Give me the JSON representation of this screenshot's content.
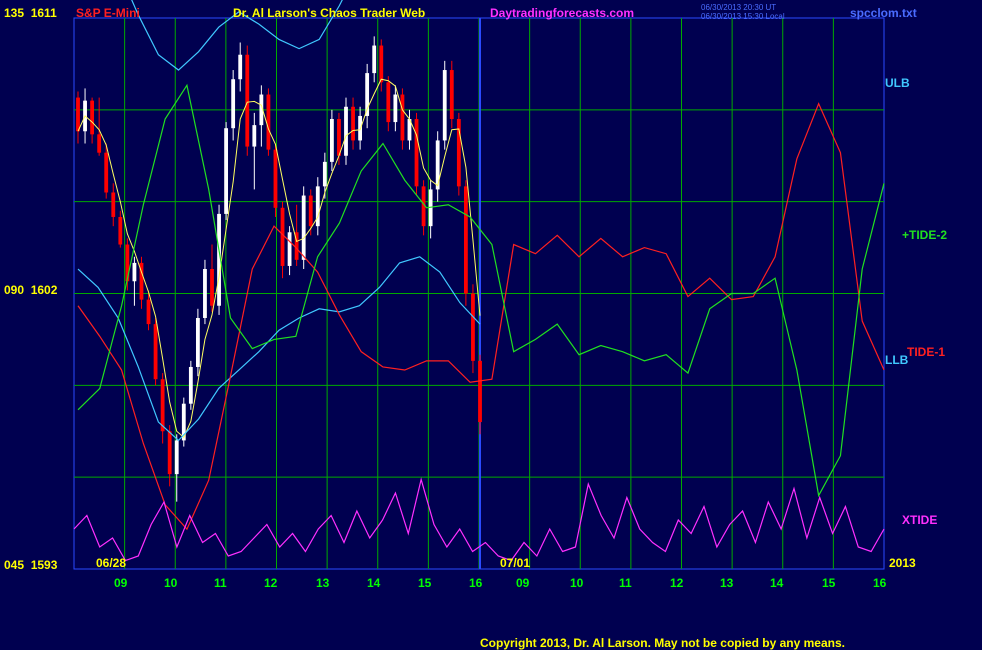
{
  "header": {
    "instrument": "S&P E-Mini",
    "title": "Dr. Al Larson's Chaos Trader Web",
    "site": "Daytradingforecasts.com",
    "stamp1": "06/30/2013 20:30 UT",
    "stamp2": "06/30/2013 15:30 Local",
    "filename": "spcclom.txt"
  },
  "colors": {
    "background": "#000050",
    "grid": "#00aa00",
    "now_line": "#2a4aff",
    "ulb": "#40c8ff",
    "llb": "#40c8ff",
    "tide1": "#ff2020",
    "tide2": "#20e020",
    "xtide": "#ff30ff",
    "up_bar": "#ffffff",
    "down_bar": "#ff0000",
    "text_yellow": "#ffff00"
  },
  "footer": {
    "copyright": "Copyright 2013, Dr. Al Larson. May not be copied by any means."
  },
  "chart_data": {
    "type": "line",
    "y_axis_labels": [
      {
        "code": "135",
        "price": "1611"
      },
      {
        "code": "090",
        "price": "1602"
      },
      {
        "code": "045",
        "price": "1593"
      }
    ],
    "ylim": [
      1593,
      1611
    ],
    "x_hours": [
      "09",
      "10",
      "11",
      "12",
      "13",
      "14",
      "15",
      "16",
      "09",
      "10",
      "11",
      "12",
      "13",
      "14",
      "15",
      "16"
    ],
    "date_labels": {
      "start": "06/28",
      "mid": "07/01",
      "end": "2013"
    },
    "curve_labels": {
      "ulb": "ULB",
      "tide2": "+TIDE-2",
      "tide1": "TIDE-1",
      "llb": "LLB",
      "xtide": "XTIDE"
    },
    "price_bars": [
      [
        1608.4,
        1608.6,
        1606.9,
        1607.3
      ],
      [
        1607.3,
        1608.7,
        1606.9,
        1608.3
      ],
      [
        1608.3,
        1608.4,
        1606.9,
        1607.2
      ],
      [
        1607.2,
        1608.4,
        1606.5,
        1606.6
      ],
      [
        1606.6,
        1606.9,
        1605.1,
        1605.3
      ],
      [
        1605.3,
        1605.6,
        1604.2,
        1604.5
      ],
      [
        1604.5,
        1604.7,
        1603.5,
        1603.6
      ],
      [
        1603.6,
        1603.8,
        1602.1,
        1602.4
      ],
      [
        1602.4,
        1603.2,
        1601.6,
        1603.0
      ],
      [
        1603.0,
        1603.2,
        1601.5,
        1601.8
      ],
      [
        1601.8,
        1602.1,
        1600.8,
        1601.0
      ],
      [
        1601.0,
        1601.2,
        1599.0,
        1599.2
      ],
      [
        1599.2,
        1599.4,
        1597.1,
        1597.5
      ],
      [
        1597.5,
        1597.7,
        1595.7,
        1596.1
      ],
      [
        1596.1,
        1597.4,
        1595.2,
        1597.2
      ],
      [
        1597.2,
        1598.6,
        1597.0,
        1598.4
      ],
      [
        1598.4,
        1599.8,
        1598.2,
        1599.6
      ],
      [
        1599.6,
        1601.5,
        1599.3,
        1601.2
      ],
      [
        1601.2,
        1603.1,
        1601.0,
        1602.8
      ],
      [
        1602.8,
        1603.6,
        1601.4,
        1601.6
      ],
      [
        1601.6,
        1604.9,
        1601.3,
        1604.6
      ],
      [
        1604.6,
        1607.6,
        1604.4,
        1607.4
      ],
      [
        1607.4,
        1609.3,
        1607.0,
        1609.0
      ],
      [
        1609.0,
        1610.2,
        1608.6,
        1609.8
      ],
      [
        1609.8,
        1610.1,
        1606.5,
        1606.8
      ],
      [
        1606.8,
        1607.9,
        1605.4,
        1607.5
      ],
      [
        1607.5,
        1608.8,
        1606.8,
        1608.5
      ],
      [
        1608.5,
        1608.7,
        1606.5,
        1606.7
      ],
      [
        1606.7,
        1606.9,
        1604.5,
        1604.8
      ],
      [
        1604.8,
        1605.0,
        1602.5,
        1602.9
      ],
      [
        1602.9,
        1604.2,
        1602.6,
        1604.0
      ],
      [
        1604.0,
        1604.9,
        1602.9,
        1603.1
      ],
      [
        1603.1,
        1605.5,
        1602.8,
        1605.2
      ],
      [
        1605.2,
        1605.4,
        1603.9,
        1604.2
      ],
      [
        1604.2,
        1605.8,
        1603.9,
        1605.5
      ],
      [
        1605.5,
        1606.6,
        1605.1,
        1606.3
      ],
      [
        1606.3,
        1608.0,
        1606.0,
        1607.7
      ],
      [
        1607.7,
        1607.9,
        1606.2,
        1606.5
      ],
      [
        1606.5,
        1608.4,
        1606.2,
        1608.1
      ],
      [
        1608.1,
        1608.4,
        1606.7,
        1607.0
      ],
      [
        1607.0,
        1608.1,
        1606.7,
        1607.8
      ],
      [
        1607.8,
        1609.5,
        1607.4,
        1609.2
      ],
      [
        1609.2,
        1610.4,
        1608.9,
        1610.1
      ],
      [
        1610.1,
        1610.3,
        1608.6,
        1608.9
      ],
      [
        1608.9,
        1609.1,
        1607.3,
        1607.6
      ],
      [
        1607.6,
        1608.8,
        1607.3,
        1608.5
      ],
      [
        1608.5,
        1608.7,
        1606.7,
        1607.0
      ],
      [
        1607.0,
        1608.0,
        1606.7,
        1607.7
      ],
      [
        1607.7,
        1607.9,
        1605.2,
        1605.5
      ],
      [
        1605.5,
        1605.7,
        1603.9,
        1604.2
      ],
      [
        1604.2,
        1605.7,
        1603.8,
        1605.4
      ],
      [
        1605.4,
        1607.3,
        1605.0,
        1607.0
      ],
      [
        1607.0,
        1609.6,
        1606.7,
        1609.3
      ],
      [
        1609.3,
        1609.6,
        1607.4,
        1607.7
      ],
      [
        1607.7,
        1607.9,
        1605.2,
        1605.5
      ],
      [
        1605.5,
        1605.7,
        1601.6,
        1602.0
      ],
      [
        1602.0,
        1602.3,
        1599.4,
        1599.8
      ],
      [
        1599.8,
        1600.0,
        1597.4,
        1597.8
      ]
    ],
    "series": [
      {
        "name": "ULB",
        "y": [
          1614.4,
          1614.1,
          1612.6,
          1611.1,
          1609.8,
          1609.3,
          1609.9,
          1610.7,
          1611.2,
          1610.8,
          1610.3,
          1610.0,
          1610.3,
          1611.4,
          1612.7,
          1613.6,
          1614.3,
          1614.9,
          1614.6,
          1613.4,
          1612.3
        ]
      },
      {
        "name": "LLB",
        "y": [
          1602.8,
          1602.2,
          1601.2,
          1599.6,
          1597.8,
          1597.2,
          1597.9,
          1598.9,
          1599.5,
          1600.1,
          1600.8,
          1601.2,
          1601.5,
          1601.4,
          1601.6,
          1602.2,
          1603.0,
          1603.2,
          1602.7,
          1601.7,
          1601.0
        ]
      },
      {
        "name": "TIDE-1",
        "y": [
          1601.6,
          1600.6,
          1599.5,
          1597.1,
          1595.1,
          1594.3,
          1595.9,
          1599.3,
          1602.8,
          1604.2,
          1603.5,
          1602.7,
          1601.3,
          1600.1,
          1599.6,
          1599.5,
          1599.8,
          1599.8,
          1599.1,
          1599.2,
          1603.6,
          1603.3,
          1603.9,
          1603.2,
          1603.8,
          1603.2,
          1603.5,
          1603.3,
          1601.9,
          1602.5,
          1601.8,
          1601.9,
          1603.2,
          1606.4,
          1608.2,
          1606.6,
          1601.1,
          1599.5
        ]
      },
      {
        "name": "TIDE-2",
        "y": [
          1598.2,
          1598.9,
          1601.6,
          1604.9,
          1607.7,
          1608.8,
          1605.4,
          1601.2,
          1600.2,
          1600.5,
          1600.6,
          1603.2,
          1604.3,
          1606.0,
          1606.9,
          1605.7,
          1604.8,
          1604.9,
          1604.5,
          1603.6,
          1600.1,
          1600.5,
          1601.0,
          1600.0,
          1600.3,
          1600.1,
          1599.8,
          1600.0,
          1599.4,
          1601.5,
          1602.0,
          1602.0,
          1602.5,
          1599.5,
          1595.4,
          1596.7,
          1602.8,
          1605.6
        ]
      },
      {
        "name": "XTIDE",
        "y": [
          0.4,
          0.55,
          0.2,
          0.3,
          0.05,
          0.1,
          0.45,
          0.7,
          0.2,
          0.55,
          0.25,
          0.35,
          0.1,
          0.15,
          0.3,
          0.45,
          0.2,
          0.35,
          0.15,
          0.4,
          0.55,
          0.25,
          0.6,
          0.3,
          0.5,
          0.8,
          0.35,
          0.95,
          0.45,
          0.2,
          0.4,
          0.15,
          0.25,
          0.1,
          0.05,
          0.25,
          0.1,
          0.4,
          0.15,
          0.2,
          0.9,
          0.55,
          0.3,
          0.75,
          0.4,
          0.25,
          0.15,
          0.5,
          0.35,
          0.65,
          0.2,
          0.45,
          0.6,
          0.25,
          0.7,
          0.4,
          0.85,
          0.3,
          0.75,
          0.35,
          0.65,
          0.2,
          0.15,
          0.4
        ]
      }
    ]
  }
}
